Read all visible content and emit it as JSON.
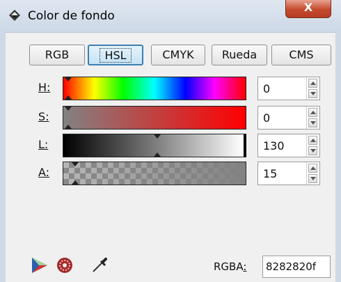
{
  "window": {
    "title": "Color de fondo",
    "close_label": "X"
  },
  "tabs": [
    {
      "label": "RGB",
      "active": false
    },
    {
      "label": "HSL",
      "active": true
    },
    {
      "label": "CMYK",
      "active": false
    },
    {
      "label": "Rueda",
      "active": false
    },
    {
      "label": "CMS",
      "active": false
    }
  ],
  "channels": [
    {
      "key": "H",
      "label": "H:",
      "value": "0"
    },
    {
      "key": "S",
      "label": "S:",
      "value": "0"
    },
    {
      "key": "L",
      "label": "L:",
      "value": "130"
    },
    {
      "key": "A",
      "label": "A:",
      "value": "15"
    }
  ],
  "footer": {
    "rgba_label": "RGBA",
    "rgba_colon": ":",
    "rgba_value": "8282820f",
    "icons": [
      "gamut-triangle-icon",
      "color-managed-icon",
      "eyedropper-icon"
    ]
  }
}
